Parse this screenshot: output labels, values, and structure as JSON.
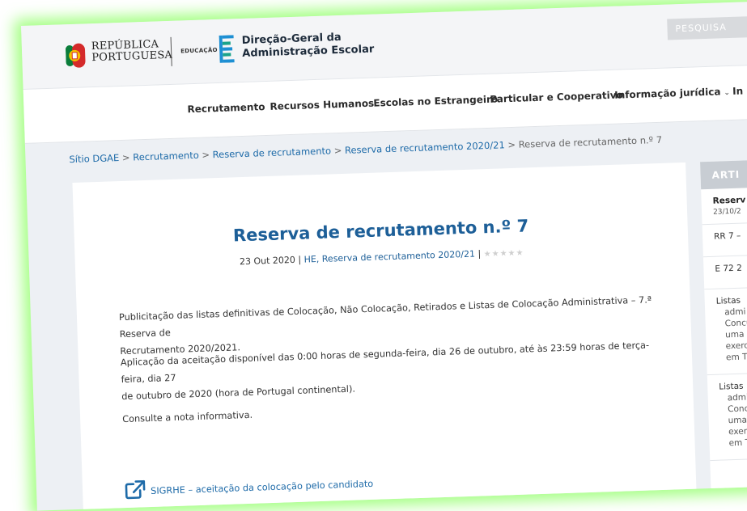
{
  "header": {
    "republic_line1": "REPÚBLICA",
    "republic_line2": "PORTUGUESA",
    "edu_label": "EDUCAÇÃO",
    "dgae_line1": "Direção-Geral da",
    "dgae_line2": "Administração Escolar",
    "search_label": "PESQUISA"
  },
  "nav": {
    "items": [
      "Recrutamento",
      "Recursos Humanos",
      "Escolas no Estrangeiro",
      "Particular e Cooperativo",
      "Informação jurídica",
      "In"
    ]
  },
  "breadcrumb": {
    "items": [
      "Sítio DGAE",
      "Recrutamento",
      "Reserva de recrutamento",
      "Reserva de recrutamento 2020/21"
    ],
    "current": "Reserva de recrutamento n.º 7",
    "separator": ">"
  },
  "article": {
    "title": "Reserva de recrutamento n.º 7",
    "date": "23 Out 2020",
    "categories": "HE, Reserva de recrutamento 2020/21",
    "rating_stars": 0,
    "para1_line1": "Publicitação das listas definitivas de Colocação, Não Colocação, Retirados e Listas de Colocação Administrativa – 7.ª Reserva de",
    "para1_line2": "Recrutamento 2020/2021.",
    "para2_line1": "Aplicação da aceitação disponível das 0:00 horas de segunda-feira, dia 26 de outubro, até às 23:59 horas de terça-feira, dia 27",
    "para2_line2": "de outubro de 2020 (hora de Portugal continental).",
    "para3": "Consulte a nota informativa.",
    "link_label": "SIGRHE – aceitação da colocação pelo candidato"
  },
  "sidebar": {
    "heading": "ARTI",
    "items": [
      {
        "title": "Reserv",
        "date": "23/10/2"
      },
      {
        "title": "RR 7 –"
      },
      {
        "title": "E 72 2"
      },
      {
        "lines": [
          "Listas",
          "admi",
          "Concu",
          "uma l",
          "exerc",
          "em Ti"
        ]
      },
      {
        "lines": [
          "Listas",
          "admi",
          "Conc",
          "uma",
          "exerc",
          "em T"
        ]
      }
    ]
  },
  "colors": {
    "accent": "#1d5f98",
    "link": "#1d6aa8",
    "frame_glow": "#86ff5a",
    "background": "#edf0f4"
  }
}
